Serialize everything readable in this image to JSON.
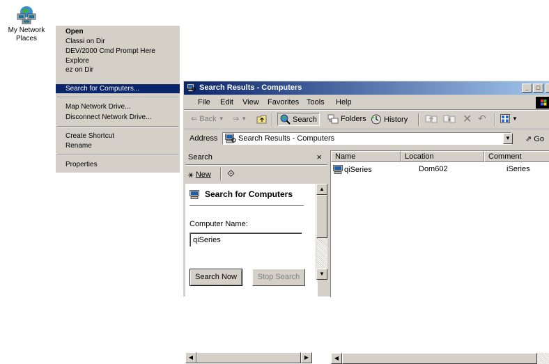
{
  "desktop": {
    "icon_label_line1": "My Network",
    "icon_label_line2": "Places"
  },
  "context_menu": {
    "items": [
      {
        "label": "Open",
        "bold": true
      },
      {
        "label": "Classi on Dir"
      },
      {
        "label": "DEV/2000 Cmd Prompt Here"
      },
      {
        "label": "Explore"
      },
      {
        "label": "ez on Dir"
      },
      {
        "label": "Search for Computers...",
        "selected": true
      },
      {
        "label": "Map Network Drive..."
      },
      {
        "label": "Disconnect Network Drive..."
      },
      {
        "label": "Create Shortcut"
      },
      {
        "label": "Rename"
      },
      {
        "label": "Properties"
      }
    ]
  },
  "window": {
    "title": "Search Results - Computers",
    "controls": {
      "minimize": "_",
      "restore": "□",
      "close": "×"
    },
    "menu": [
      "File",
      "Edit",
      "View",
      "Favorites",
      "Tools",
      "Help"
    ],
    "toolbar": {
      "back": "Back",
      "search": "Search",
      "folders": "Folders",
      "history": "History"
    },
    "address": {
      "label": "Address",
      "value": "Search Results - Computers",
      "go": "Go"
    }
  },
  "search_pane": {
    "title": "Search",
    "close": "×",
    "new_label": "New",
    "heading": "Search for Computers",
    "computer_name_label": "Computer Name:",
    "computer_name_value": "qiSeries",
    "search_now": "Search Now",
    "stop_search": "Stop Search"
  },
  "results": {
    "columns": [
      "Name",
      "Location",
      "Comment"
    ],
    "rows": [
      {
        "name": "qiSeries",
        "location": "Dom602",
        "comment": "iSeries"
      }
    ]
  },
  "colors": {
    "selection": "#0a246a",
    "face": "#d4d0c8",
    "title_gradient_end": "#a6caf0"
  }
}
